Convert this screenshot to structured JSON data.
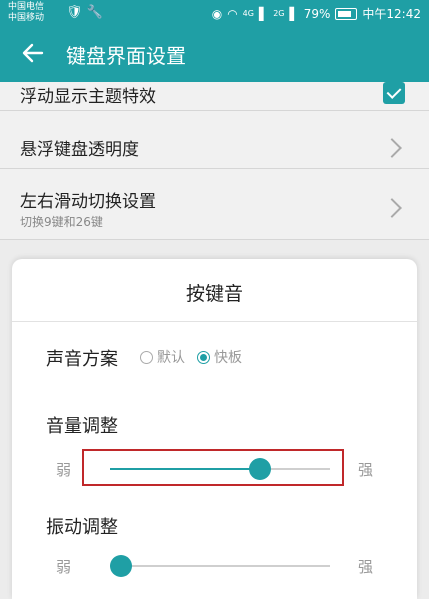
{
  "status_bar": {
    "carrier_1": "中国电信",
    "carrier_2": "中国移动",
    "left_icons": " † ☀",
    "eye_glyph": "◉",
    "signal_text": "4G",
    "signal_text_2": "2G",
    "battery": "79%",
    "time": "中午12:42"
  },
  "app_bar": {
    "title": "键盘界面设置"
  },
  "background_list": [
    {
      "title": "浮动显示主题特效"
    },
    {
      "title": "悬浮键盘透明度"
    },
    {
      "title": "左右滑动切换设置",
      "subtitle": "切换9键和26键"
    }
  ],
  "dialog": {
    "title": "按键音",
    "sound_scheme": {
      "label": "声音方案",
      "options": [
        {
          "label": "默认",
          "selected": false
        },
        {
          "label": "快板",
          "selected": true
        }
      ]
    },
    "volume": {
      "label": "音量调整",
      "min_label": "弱",
      "max_label": "强",
      "value": 0.68
    },
    "vibration": {
      "label": "振动调整",
      "min_label": "弱",
      "max_label": "强",
      "value": 0.0
    }
  },
  "colors": {
    "accent": "#1f9fa5",
    "highlight": "#c0282a"
  }
}
